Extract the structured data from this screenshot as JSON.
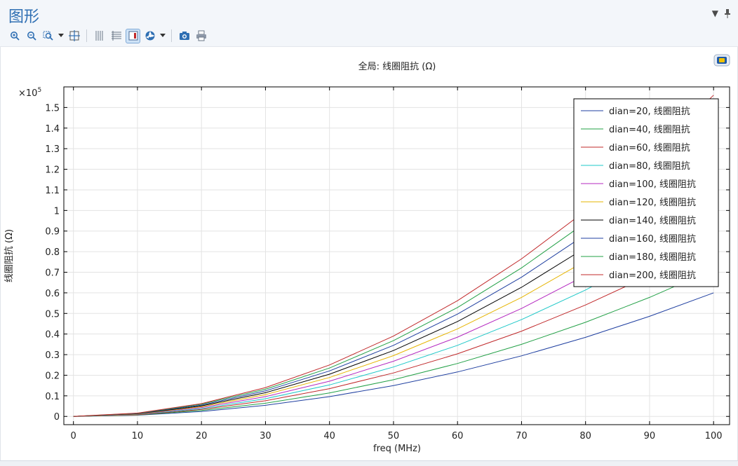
{
  "panel": {
    "title": "图形"
  },
  "toolbar": {
    "buttons": [
      "zoom-in-icon",
      "zoom-out-icon",
      "zoom-box-icon",
      "zoom-extents-icon",
      "grid-icon",
      "table-icon",
      "legend-icon",
      "color-icon",
      "snapshot-icon",
      "print-icon"
    ]
  },
  "colors": {
    "accent": "#2f6fb3",
    "series": [
      "#1f3fa0",
      "#22a046",
      "#c0282a",
      "#1ec8c8",
      "#b428c0",
      "#e6b400",
      "#000000",
      "#1f3fa0",
      "#22a046",
      "#c0282a"
    ]
  },
  "chart_data": {
    "type": "line",
    "title": "全局: 线圈阻抗 (Ω)",
    "xlabel": "freq (MHz)",
    "ylabel": "线圈阻抗 (Ω)",
    "y_multiplier": "×10⁵",
    "y_multiplier_base": "×10",
    "y_multiplier_exp": "5",
    "xlim": [
      -1.5,
      102.5
    ],
    "ylim": [
      -0.04,
      1.6
    ],
    "x_ticks": [
      "0",
      "10",
      "20",
      "30",
      "40",
      "50",
      "60",
      "70",
      "80",
      "90",
      "100"
    ],
    "y_ticks": [
      "0",
      "0.1",
      "0.2",
      "0.3",
      "0.4",
      "0.5",
      "0.6",
      "0.7",
      "0.8",
      "0.9",
      "1",
      "1.1",
      "1.2",
      "1.3",
      "1.4",
      "1.5"
    ],
    "grid": true,
    "legend_position": "top-right",
    "x": [
      0,
      10,
      20,
      30,
      40,
      50,
      60,
      70,
      80,
      90,
      100
    ],
    "series": [
      {
        "name": "dian=20, 线圈阻抗",
        "values": [
          0,
          0.006,
          0.024,
          0.054,
          0.096,
          0.15,
          0.216,
          0.294,
          0.384,
          0.486,
          0.6
        ]
      },
      {
        "name": "dian=40, 线圈阻抗",
        "values": [
          0,
          0.007,
          0.029,
          0.064,
          0.114,
          0.178,
          0.257,
          0.35,
          0.457,
          0.578,
          0.714
        ]
      },
      {
        "name": "dian=60, 线圈阻抗",
        "values": [
          0,
          0.008,
          0.034,
          0.076,
          0.135,
          0.211,
          0.304,
          0.414,
          0.541,
          0.684,
          0.845
        ]
      },
      {
        "name": "dian=80, 线圈阻抗",
        "values": [
          0,
          0.01,
          0.038,
          0.086,
          0.153,
          0.24,
          0.345,
          0.47,
          0.614,
          0.777,
          0.959
        ]
      },
      {
        "name": "dian=100, 线圈阻抗",
        "values": [
          0,
          0.011,
          0.043,
          0.096,
          0.171,
          0.268,
          0.385,
          0.524,
          0.685,
          0.867,
          1.07
        ]
      },
      {
        "name": "dian=120, 线圈阻抗",
        "values": [
          0,
          0.012,
          0.047,
          0.106,
          0.189,
          0.295,
          0.425,
          0.578,
          0.755,
          0.956,
          1.18
        ]
      },
      {
        "name": "dian=140, 线圈阻抗",
        "values": [
          0,
          0.013,
          0.051,
          0.115,
          0.205,
          0.32,
          0.461,
          0.627,
          0.819,
          1.037,
          1.28
        ]
      },
      {
        "name": "dian=160, 线圈阻抗",
        "values": [
          0,
          0.014,
          0.055,
          0.124,
          0.221,
          0.345,
          0.497,
          0.676,
          0.883,
          1.118,
          1.38
        ]
      },
      {
        "name": "dian=180, 线圈阻抗",
        "values": [
          0,
          0.015,
          0.059,
          0.132,
          0.235,
          0.368,
          0.529,
          0.721,
          0.941,
          1.191,
          1.47
        ]
      },
      {
        "name": "dian=200, 线圈阻抗",
        "values": [
          0,
          0.016,
          0.062,
          0.14,
          0.25,
          0.39,
          0.562,
          0.765,
          0.998,
          1.264,
          1.56
        ]
      }
    ]
  }
}
